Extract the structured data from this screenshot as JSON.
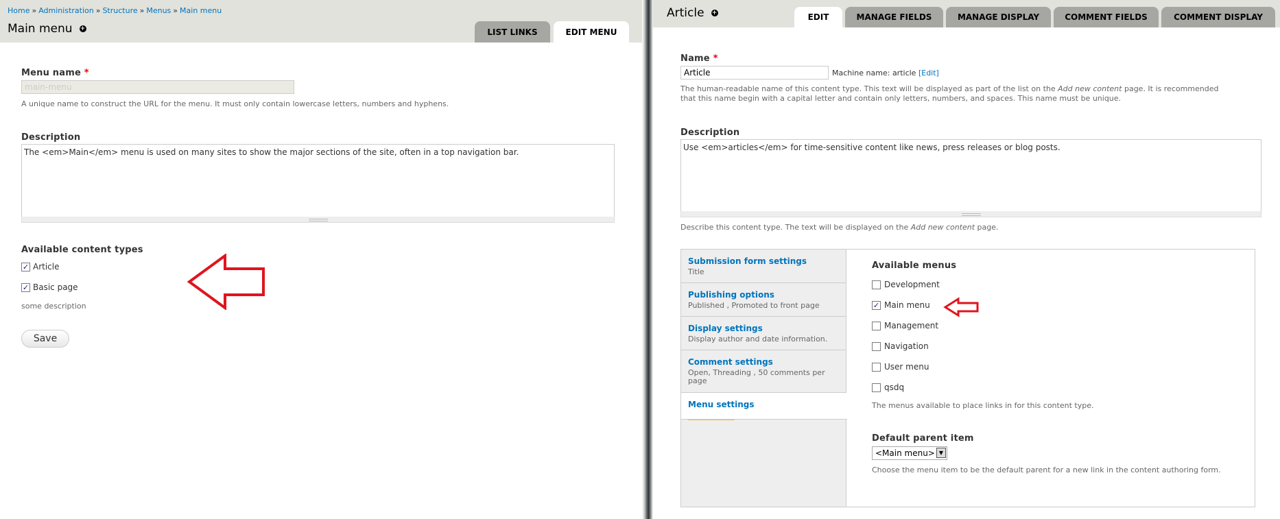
{
  "left": {
    "breadcrumb": [
      "Home",
      "Administration",
      "Structure",
      "Menus",
      "Main menu"
    ],
    "breadcrumb_sep": "»",
    "title": "Main menu",
    "tabs": [
      {
        "label": "LIST LINKS",
        "active": false
      },
      {
        "label": "EDIT MENU",
        "active": true
      }
    ],
    "menu_name": {
      "label": "Menu name",
      "required": "*",
      "value": "main-menu",
      "help": "A unique name to construct the URL for the menu. It must only contain lowercase letters, numbers and hyphens."
    },
    "description": {
      "label": "Description",
      "value": "The <em>Main</em> menu is used on many sites to show the major sections of the site, often in a top navigation bar."
    },
    "content_types": {
      "label": "Available content types",
      "items": [
        {
          "label": "Article",
          "checked": true
        },
        {
          "label": "Basic page",
          "checked": true
        }
      ],
      "help": "some description"
    },
    "save_label": "Save"
  },
  "right": {
    "title": "Article",
    "tabs": [
      {
        "label": "EDIT",
        "active": true
      },
      {
        "label": "MANAGE FIELDS",
        "active": false
      },
      {
        "label": "MANAGE DISPLAY",
        "active": false
      },
      {
        "label": "COMMENT FIELDS",
        "active": false
      },
      {
        "label": "COMMENT DISPLAY",
        "active": false
      }
    ],
    "name": {
      "label": "Name",
      "required": "*",
      "value": "Article",
      "machine_prefix": "Machine name: article",
      "machine_edit": "[Edit]",
      "help_1a": "The human-readable name of this content type. This text will be displayed as part of the list on the ",
      "help_1b": "Add new content",
      "help_1c": " page. It is recommended",
      "help_2": "that this name begin with a capital letter and contain only letters, numbers, and spaces. This name must be unique."
    },
    "description": {
      "label": "Description",
      "value": "Use <em>articles</em> for time-sensitive content like news, press releases or blog posts.",
      "help_a": "Describe this content type. The text will be displayed on the ",
      "help_b": "Add new content",
      "help_c": " page."
    },
    "vertical_tabs": [
      {
        "title": "Submission form settings",
        "summary": "Title"
      },
      {
        "title": "Publishing options",
        "summary": "Published , Promoted to front page"
      },
      {
        "title": "Display settings",
        "summary": "Display author and date information."
      },
      {
        "title": "Comment settings",
        "summary": "Open, Threading , 50 comments per page"
      },
      {
        "title": "Menu settings",
        "summary": ""
      }
    ],
    "menus": {
      "label": "Available menus",
      "items": [
        {
          "label": "Development",
          "checked": false
        },
        {
          "label": "Main menu",
          "checked": true
        },
        {
          "label": "Management",
          "checked": false
        },
        {
          "label": "Navigation",
          "checked": false
        },
        {
          "label": "User menu",
          "checked": false
        },
        {
          "label": "qsdq",
          "checked": false
        }
      ],
      "help": "The menus available to place links in for this content type."
    },
    "parent": {
      "label": "Default parent item",
      "value": "<Main menu>",
      "help": "Choose the menu item to be the default parent for a new link in the content authoring form."
    }
  },
  "colors": {
    "header_bg": "#e1e2dc",
    "tab_inactive": "#a6a7a2",
    "link": "#0074bd",
    "annotation_arrow": "#e0141e"
  }
}
